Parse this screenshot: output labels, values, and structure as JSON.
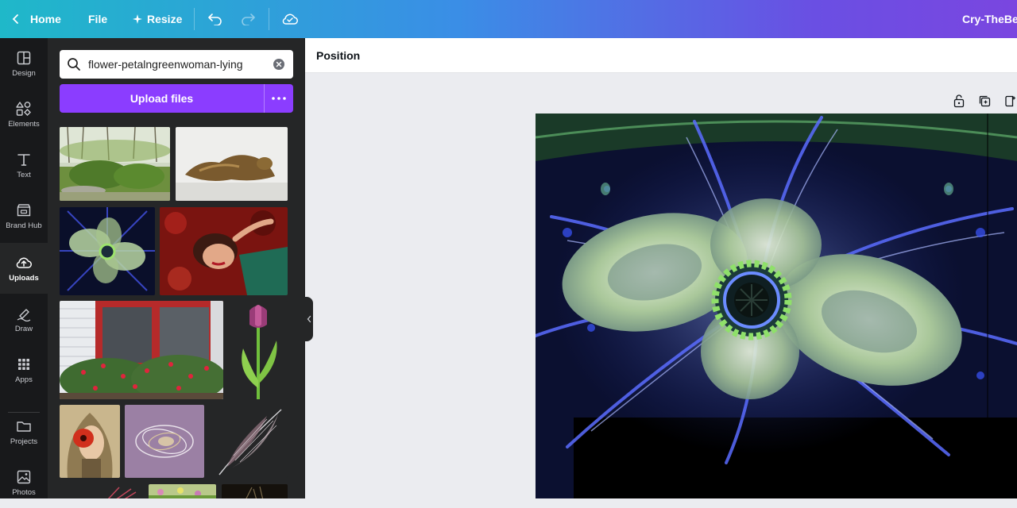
{
  "topbar": {
    "home_label": "Home",
    "file_label": "File",
    "resize_label": "Resize",
    "doc_title": "Cry-TheBel"
  },
  "rail": {
    "items": [
      {
        "label": "Design",
        "icon": "design-icon"
      },
      {
        "label": "Elements",
        "icon": "elements-icon"
      },
      {
        "label": "Text",
        "icon": "text-icon"
      },
      {
        "label": "Brand Hub",
        "icon": "brand-hub-icon"
      },
      {
        "label": "Uploads",
        "icon": "uploads-icon"
      },
      {
        "label": "Draw",
        "icon": "draw-icon"
      },
      {
        "label": "Apps",
        "icon": "apps-icon"
      },
      {
        "label": "Projects",
        "icon": "projects-icon"
      },
      {
        "label": "Photos",
        "icon": "photos-icon"
      }
    ],
    "active": "Uploads"
  },
  "panel": {
    "search_value": "flower-petalngreenwoman-lying",
    "upload_label": "Upload files"
  },
  "context_bar": {
    "position_label": "Position"
  },
  "colors": {
    "accent": "#8b3dff",
    "rail_bg": "#18191b",
    "panel_bg": "#252627",
    "workspace_bg": "#ebecf0"
  }
}
